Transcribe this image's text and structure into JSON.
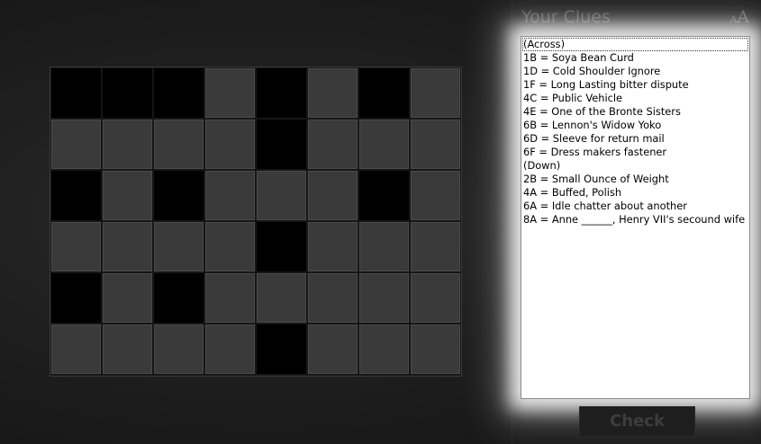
{
  "panel": {
    "title": "Your Clues",
    "font_small_glyph": "A",
    "font_large_glyph": "A",
    "check_label": "Check"
  },
  "board": {
    "rows": 6,
    "cols": 8,
    "cells": [
      [
        0,
        0,
        0,
        1,
        0,
        1,
        0,
        1
      ],
      [
        1,
        1,
        1,
        1,
        0,
        1,
        1,
        1
      ],
      [
        0,
        1,
        0,
        1,
        1,
        1,
        0,
        1
      ],
      [
        1,
        1,
        1,
        1,
        0,
        1,
        1,
        1
      ],
      [
        0,
        1,
        0,
        1,
        1,
        1,
        1,
        1
      ],
      [
        1,
        1,
        1,
        1,
        0,
        1,
        1,
        1
      ]
    ],
    "open_color": "#3a3a3a",
    "block_color": "#000000"
  },
  "clues": [
    "(Across)",
    "1B = Soya Bean Curd",
    "1D = Cold Shoulder Ignore",
    "1F = Long Lasting bitter dispute",
    "4C = Public Vehicle",
    "4E = One of the Bronte Sisters",
    "6B = Lennon's Widow Yoko",
    "6D = Sleeve for return mail",
    "6F = Dress makers fastener",
    "(Down)",
    "2B = Small Ounce of Weight",
    "4A = Buffed, Polish",
    "6A = Idle chatter about another",
    "8A = Anne ______, Henry VII's secound wife"
  ]
}
